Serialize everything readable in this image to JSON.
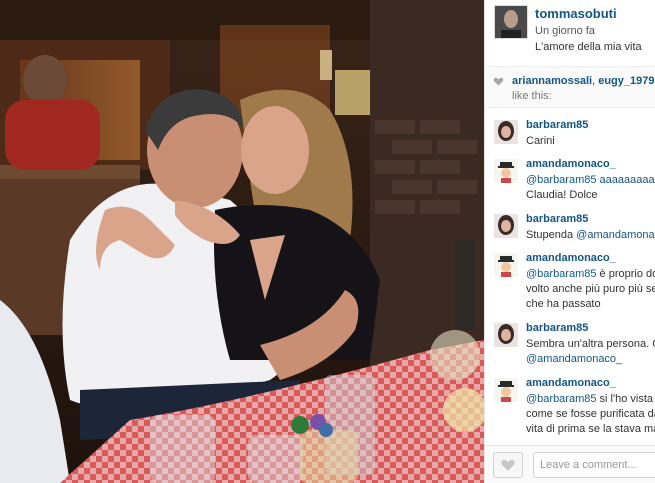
{
  "post": {
    "username": "tommasobuti",
    "time": "Un giorno fa",
    "caption": "L'amore della mia vita"
  },
  "likes": {
    "user1": "ariannamossali",
    "separator": ", ",
    "user2": "eugy_1979",
    "suffix": ",",
    "line2": "like this:"
  },
  "comments": [
    {
      "user": "barbaram85",
      "lines": [
        "Carini"
      ],
      "avatar": "woman-avatar"
    },
    {
      "user": "amandamonaco_",
      "lines": [
        "@barbaram85 aaaaaaaaa",
        "Claudia! Dolce⁣"
      ],
      "avatar": "cartoon-avatar"
    },
    {
      "user": "barbaram85",
      "lines": [
        "Stupenda @amandamonaco"
      ],
      "avatar": "woman-avatar"
    },
    {
      "user": "amandamonaco_",
      "lines": [
        "@barbaram85 è proprio do",
        "volto anche più puro più se",
        "che ha passato⁣⁣⁣"
      ],
      "avatar": "cartoon-avatar"
    },
    {
      "user": "barbaram85",
      "lines": [
        "Sembra un'altra persona. G",
        "@amandamonaco_"
      ],
      "avatar": "woman-avatar"
    },
    {
      "user": "amandamonaco_",
      "lines": [
        "@barbaram85 si l'ho vista p",
        "come se fosse purificata da",
        "vita di prima se la stava ma"
      ],
      "avatar": "cartoon-avatar"
    }
  ],
  "footer": {
    "comment_placeholder": "Leave a comment..."
  },
  "colors": {
    "link": "#125688",
    "text": "#333333"
  }
}
